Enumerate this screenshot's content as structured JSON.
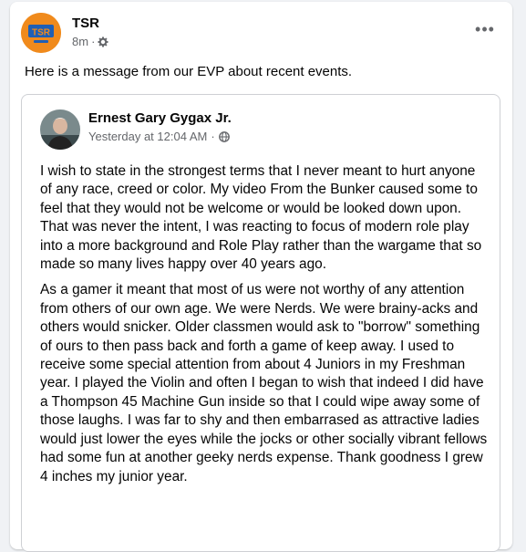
{
  "post": {
    "author": "TSR",
    "time": "8m",
    "separator": "·",
    "audience_icon": "gear-icon",
    "more_icon": "more-horizontal-icon",
    "more_label": "•••",
    "text": "Here is a message from our EVP about recent events.",
    "avatar_logo_text": "TSR"
  },
  "shared_post": {
    "author": "Ernest Gary Gygax Jr.",
    "time": "Yesterday at 12:04 AM",
    "separator": "·",
    "audience_icon": "globe-icon",
    "paragraphs": [
      "I wish to state in the strongest terms that I never meant to hurt anyone of any race, creed or color. My video From the Bunker caused some to feel that they would not be welcome or would be looked down upon. That was never the intent, I was reacting to focus of modern role play into a more background and Role Play rather than the wargame that so made so many lives happy over 40 years ago.",
      "As a gamer it meant that most of us were not worthy of any attention from others of our own age. We were Nerds. We were brainy-acks and others would snicker. Older classmen would ask to \"borrow\" something of ours to then pass back and forth a game of keep away. I used to receive some special attention from about 4 Juniors in my Freshman year. I played the Violin and often I began to wish that indeed I did have a Thompson 45 Machine Gun inside so that I could wipe away some of those laughs. I was far to shy and then embarrased as attractive ladies would just lower the eyes while the jocks or other socially vibrant fellows had some fun at another geeky nerds expense. Thank goodness I grew 4 inches my junior year."
    ]
  },
  "colors": {
    "background": "#f0f2f5",
    "card": "#ffffff",
    "text": "#050505",
    "secondary_text": "#65676b",
    "avatar_orange": "#f08a1c",
    "logo_blue": "#1f5fb5"
  }
}
